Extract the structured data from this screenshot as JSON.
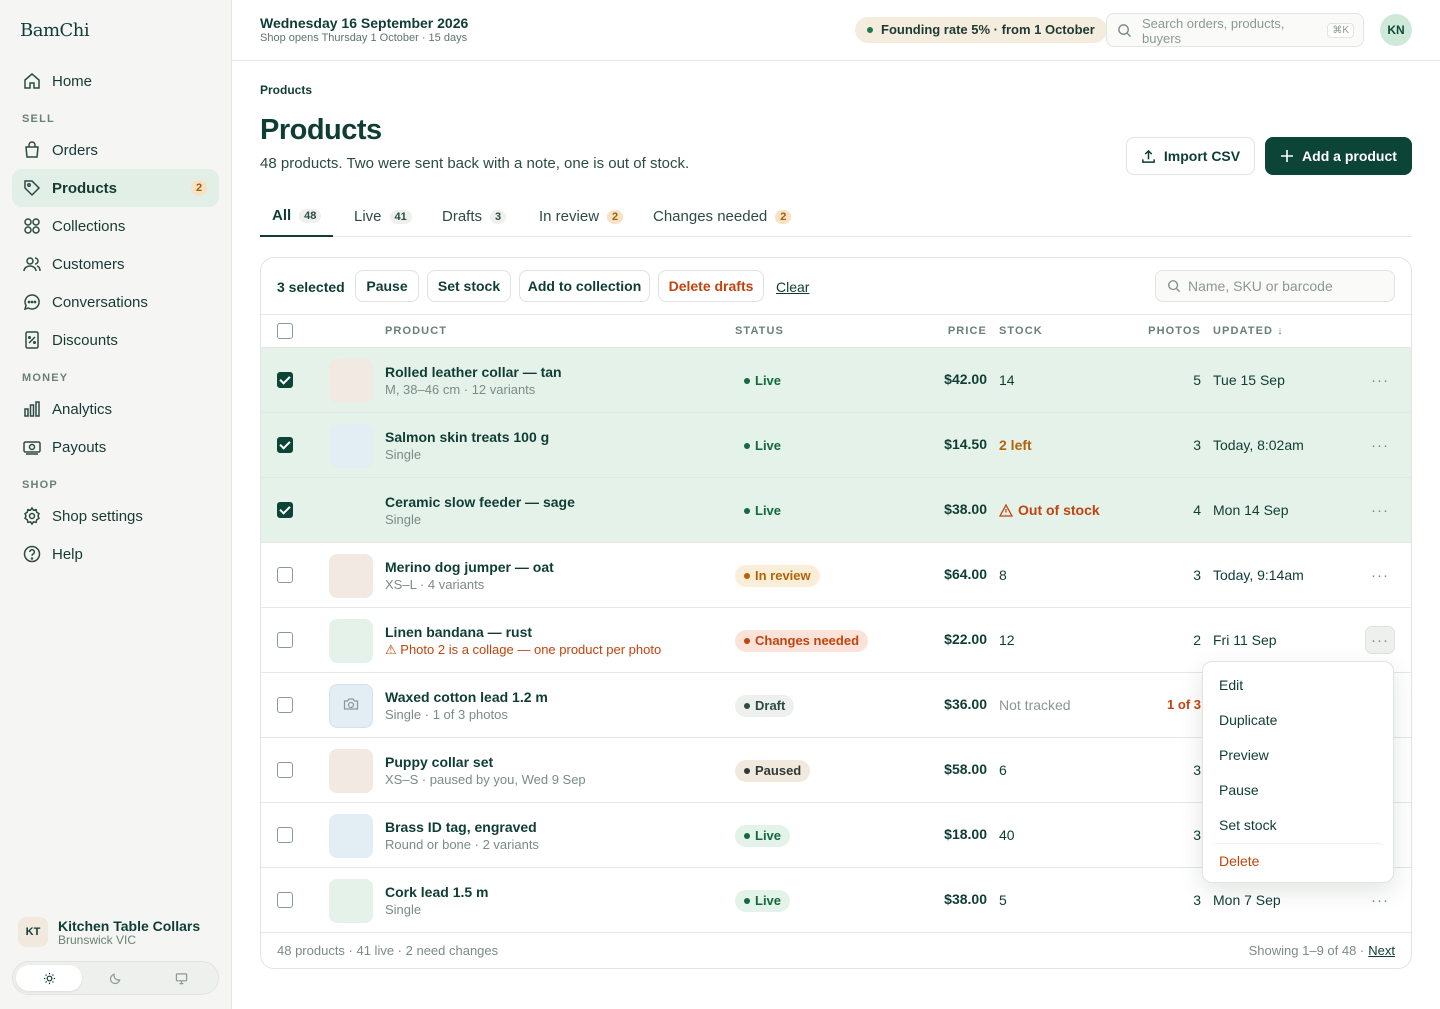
{
  "app": {
    "logo": "BamChi"
  },
  "sidebar": {
    "home": "Home",
    "sections": {
      "sell": "SELL",
      "money": "MONEY",
      "shop": "SHOP"
    },
    "items": [
      {
        "label": "Orders",
        "icon": "bag-icon"
      },
      {
        "label": "Products",
        "icon": "tag-icon",
        "badge": "2",
        "active": true
      },
      {
        "label": "Collections",
        "icon": "grid-icon"
      },
      {
        "label": "Customers",
        "icon": "users-icon"
      },
      {
        "label": "Conversations",
        "icon": "chat-icon"
      },
      {
        "label": "Discounts",
        "icon": "discount-icon"
      },
      {
        "label": "Analytics",
        "icon": "chart-icon"
      },
      {
        "label": "Payouts",
        "icon": "payout-icon"
      },
      {
        "label": "Shop settings",
        "icon": "gear-icon"
      },
      {
        "label": "Help",
        "icon": "help-icon"
      }
    ],
    "shop": {
      "initials": "KT",
      "name": "Kitchen Table Collars",
      "location": "Brunswick VIC"
    }
  },
  "topbar": {
    "date": "Wednesday 16 September 2026",
    "subtitle": "Shop opens Thursday 1 October · 15 days",
    "founding": "Founding rate 5% · from 1 October",
    "search_placeholder": "Search orders, products, buyers",
    "shortcut": "⌘K",
    "user_initials": "KN"
  },
  "page": {
    "breadcrumb": "Products",
    "title": "Products",
    "subtitle": "48 products. Two were sent back with a note, one is out of stock.",
    "import_label": "Import CSV",
    "add_label": "Add a product"
  },
  "tabs": [
    {
      "label": "All",
      "count": "48"
    },
    {
      "label": "Live",
      "count": "41"
    },
    {
      "label": "Drafts",
      "count": "3"
    },
    {
      "label": "In review",
      "count": "2"
    },
    {
      "label": "Changes needed",
      "count": "2"
    }
  ],
  "bulk": {
    "selected": "3 selected",
    "pause": "Pause",
    "set_stock": "Set stock",
    "add_collection": "Add to collection",
    "delete_drafts": "Delete drafts",
    "clear": "Clear",
    "search_placeholder": "Name, SKU or barcode"
  },
  "columns": {
    "product": "PRODUCT",
    "status": "STATUS",
    "price": "PRICE",
    "stock": "STOCK",
    "photos": "PHOTOS",
    "updated": "UPDATED"
  },
  "rows": [
    {
      "name": "Rolled leather collar — tan",
      "meta": "M, 38–46 cm · 12 variants",
      "status": "Live",
      "price": "$42.00",
      "stock": "14",
      "photos": "5",
      "updated": "Tue 15 Sep"
    },
    {
      "name": "Salmon skin treats 100 g",
      "meta": "Single",
      "status": "Live",
      "price": "$14.50",
      "stock": "2 left",
      "photos": "3",
      "updated": "Today, 8:02am"
    },
    {
      "name": "Ceramic slow feeder — sage",
      "meta": "Single",
      "status": "Live",
      "price": "$38.00",
      "stock": "Out of stock",
      "photos": "4",
      "updated": "Mon 14 Sep"
    },
    {
      "name": "Merino dog jumper — oat",
      "meta": "XS–L · 4 variants",
      "status": "In review",
      "price": "$64.00",
      "stock": "8",
      "photos": "3",
      "updated": "Today, 9:14am"
    },
    {
      "name": "Linen bandana — rust",
      "meta": "Photo 2 is a collage — one product per photo",
      "status": "Changes needed",
      "price": "$22.00",
      "stock": "12",
      "photos": "2",
      "updated": "Fri 11 Sep"
    },
    {
      "name": "Waxed cotton lead 1.2 m",
      "meta": "Single · 1 of 3 photos",
      "status": "Draft",
      "price": "$36.00",
      "stock": "Not tracked",
      "photos": "1 of 3"
    },
    {
      "name": "Puppy collar set",
      "meta": "XS–S · paused by you, Wed 9 Sep",
      "status": "Paused",
      "price": "$58.00",
      "stock": "6",
      "photos": "3"
    },
    {
      "name": "Brass ID tag, engraved",
      "meta": "Round or bone · 2 variants",
      "status": "Live",
      "price": "$18.00",
      "stock": "40",
      "photos": "3"
    },
    {
      "name": "Cork lead 1.5 m",
      "meta": "Single",
      "status": "Live",
      "price": "$38.00",
      "stock": "5",
      "photos": "3",
      "updated": "Mon 7 Sep"
    }
  ],
  "menu": [
    "Edit",
    "Duplicate",
    "Preview",
    "Pause",
    "Set stock",
    "Delete"
  ],
  "footer": {
    "summary": "48 products · 41 live · 2 need changes",
    "showing": "Showing 1–9 of 48 ·",
    "next": "Next"
  },
  "colors": {
    "accent": "#0d4438",
    "selected_row": "#e5f2ea",
    "danger": "#c1440e",
    "warning": "#b46308"
  }
}
